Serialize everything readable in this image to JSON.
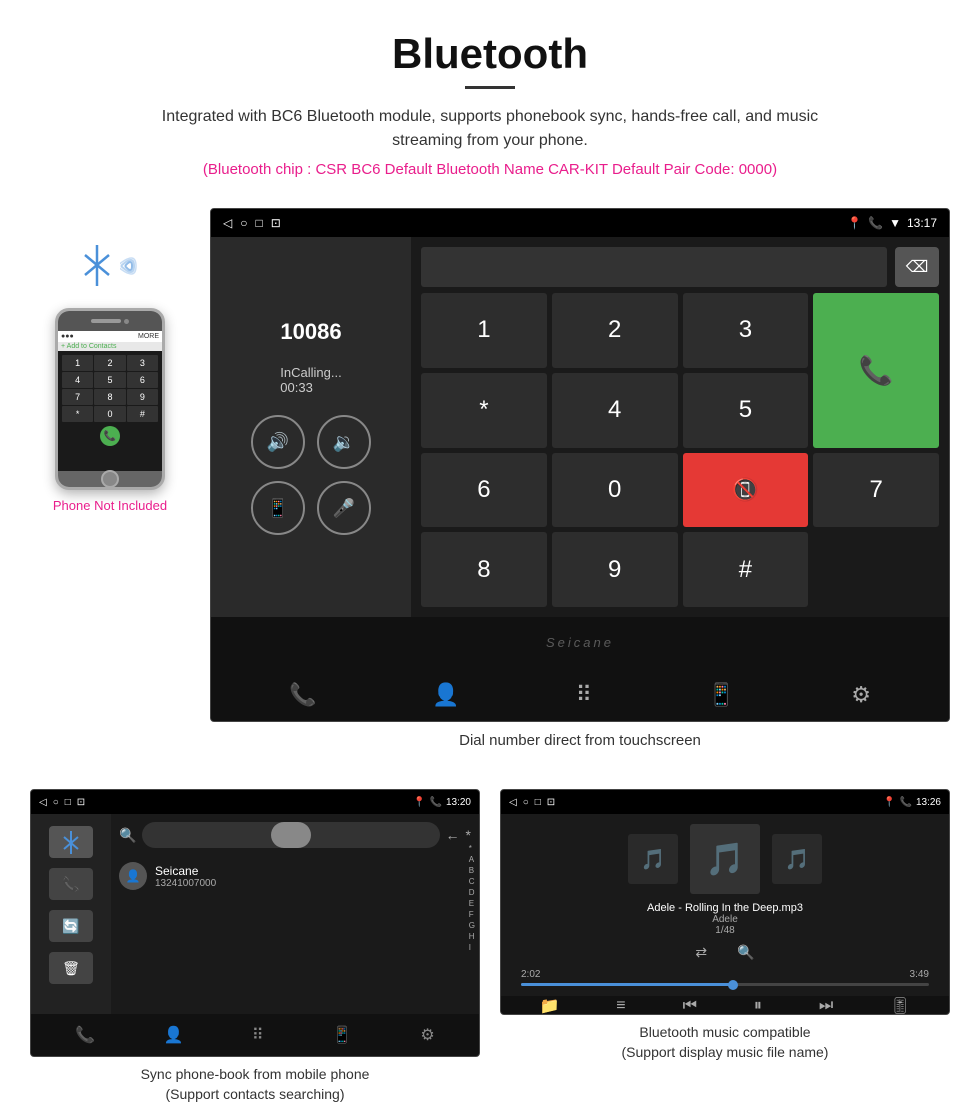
{
  "page": {
    "title": "Bluetooth",
    "description": "Integrated with BC6 Bluetooth module, supports phonebook sync, hands-free call, and music streaming from your phone.",
    "specs_line": "(Bluetooth chip : CSR BC6    Default Bluetooth Name CAR-KIT    Default Pair Code: 0000)"
  },
  "main_screen": {
    "status_bar": {
      "left_icons": [
        "◁",
        "○",
        "□",
        "⊡"
      ],
      "right_icons": [
        "📍",
        "📞",
        "▼"
      ],
      "time": "13:17"
    },
    "phone_number": "10086",
    "call_status": "InCalling...",
    "call_timer": "00:33",
    "keypad": {
      "keys": [
        "1",
        "2",
        "3",
        "*",
        "4",
        "5",
        "6",
        "0",
        "7",
        "8",
        "9",
        "#"
      ]
    },
    "caption": "Dial number direct from touchscreen",
    "watermark": "Seicane"
  },
  "phonebook_screen": {
    "status_bar": {
      "time": "13:20"
    },
    "contact": {
      "name": "Seicane",
      "number": "13241007000"
    },
    "alpha_list": [
      "*",
      "A",
      "B",
      "C",
      "D",
      "E",
      "F",
      "G",
      "H",
      "I"
    ],
    "caption_line1": "Sync phone-book from mobile phone",
    "caption_line2": "(Support contacts searching)"
  },
  "music_screen": {
    "status_bar": {
      "time": "13:26"
    },
    "song_title": "Adele - Rolling In the Deep.mp3",
    "artist": "Adele",
    "track": "1/48",
    "time_current": "2:02",
    "time_total": "3:49",
    "progress_percent": 52,
    "caption_line1": "Bluetooth music compatible",
    "caption_line2": "(Support display music file name)"
  },
  "phone_illustration": {
    "not_included_text": "Phone Not Included"
  },
  "nav_icons": {
    "call": "📞",
    "contact": "👤",
    "grid": "⋮⋮⋮",
    "phone_transfer": "📱",
    "settings": "⚙"
  }
}
